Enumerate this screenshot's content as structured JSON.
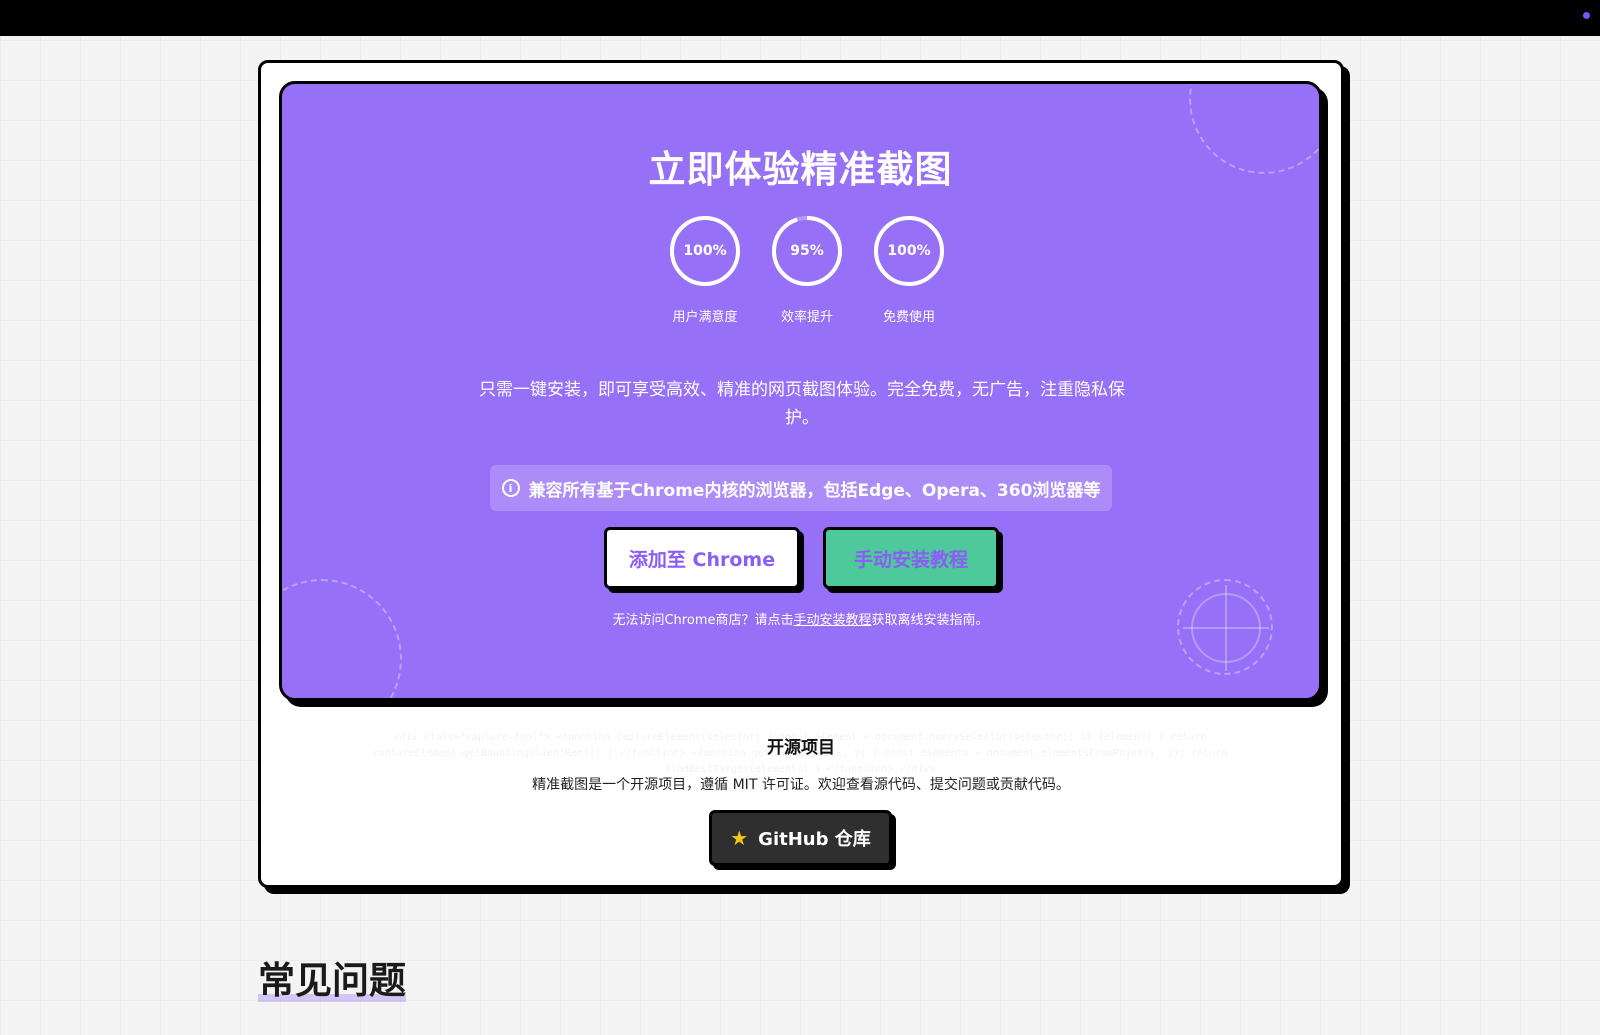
{
  "cta": {
    "title": "立即体验精准截图",
    "stats": [
      {
        "value": "100%",
        "label": "用户满意度",
        "progress": 1.0
      },
      {
        "value": "95%",
        "label": "效率提升",
        "progress": 0.95
      },
      {
        "value": "100%",
        "label": "免费使用",
        "progress": 1.0
      }
    ],
    "description": "只需一键安装，即可享受高效、精准的网页截图体验。完全免费，无广告，注重隐私保护。",
    "compat_note": "兼容所有基于Chrome内核的浏览器，包括Edge、Opera、360浏览器等",
    "add_chrome_label": "添加至 Chrome",
    "manual_install_label": "手动安装教程",
    "note_prefix": "无法访问Chrome商店？请点击",
    "note_link": "手动安装教程",
    "note_suffix": "获取离线安装指南。"
  },
  "open_source": {
    "title": "开源项目",
    "description": "精准截图是一个开源项目，遵循 MIT 许可证。欢迎查看源代码、提交问题或贡献代码。",
    "github_label": "GitHub 仓库"
  },
  "faq": {
    "title": "常见问题"
  },
  "icons": {
    "info": "info-icon",
    "star": "star-icon"
  },
  "colors": {
    "cta_bg": "#9670f7",
    "accent_green": "#4ec99b",
    "button_text": "#8b5cf6",
    "github_bg": "#2f2f2f"
  }
}
